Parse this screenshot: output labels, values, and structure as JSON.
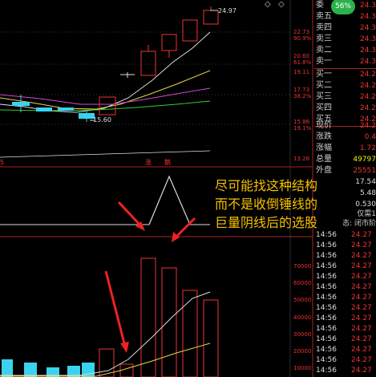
{
  "kline": {
    "last_price_label": "24.97",
    "low_price_label": "15.60",
    "axis_prices": [
      "22.73",
      "90.9%",
      "20.60",
      "61.8%",
      "19.11",
      "17.73",
      "38.2%",
      "15.86",
      "19.1%",
      "13.26"
    ],
    "marker_left": "5",
    "marker_mid": "涨",
    "marker_right": "鹅"
  },
  "volume_axis": [
    "70000",
    "60000",
    "50000",
    "40000",
    "30000",
    "20000",
    "10000"
  ],
  "annotation": {
    "line1": "尽可能找这种结构",
    "line2": "而不是收倒锤线的",
    "line3": "巨量阴线后的选股"
  },
  "badge": {
    "percent": "56%"
  },
  "quote_panel": {
    "header_label": "委",
    "sells": [
      {
        "label": "卖五",
        "value": "24.3"
      },
      {
        "label": "卖四",
        "value": "24.3"
      },
      {
        "label": "卖三",
        "value": "24.3"
      },
      {
        "label": "卖二",
        "value": "24.3"
      },
      {
        "label": "卖一",
        "value": "24.3"
      }
    ],
    "header_value": "24.3",
    "buys": [
      {
        "label": "买一",
        "value": "24.2"
      },
      {
        "label": "买二",
        "value": "24.2"
      },
      {
        "label": "买三",
        "value": "24.2"
      },
      {
        "label": "买四",
        "value": "24.2"
      },
      {
        "label": "买五",
        "value": "24.2"
      }
    ],
    "stats": [
      {
        "label": "现价",
        "value": "24.2"
      },
      {
        "label": "涨跌",
        "value": "0.4"
      },
      {
        "label": "涨幅",
        "value": "1.72"
      },
      {
        "label": "总量",
        "value": "49797"
      },
      {
        "label": "外盘",
        "value": "25551"
      }
    ],
    "extra_values": [
      "17.54",
      "5.48",
      "0.530"
    ],
    "status_line1": "仅需1",
    "status_line2": "态: 闭市阶"
  },
  "ticks": [
    {
      "time": "14:56",
      "price": "24.27"
    },
    {
      "time": "14:56",
      "price": "24.27"
    },
    {
      "time": "14:56",
      "price": "24.27"
    },
    {
      "time": "14:56",
      "price": "24.27"
    },
    {
      "time": "14:56",
      "price": "24.27"
    },
    {
      "time": "14:56",
      "price": "24.27"
    },
    {
      "time": "14:56",
      "price": "24.27"
    },
    {
      "time": "14:56",
      "price": "24.27"
    },
    {
      "time": "14:56",
      "price": "24.27"
    },
    {
      "time": "14:56",
      "price": "24.27"
    },
    {
      "time": "14:56",
      "price": "24.27"
    },
    {
      "time": "14:56",
      "price": "24.27"
    },
    {
      "time": "14:56",
      "price": "24.27"
    },
    {
      "time": "14:56",
      "price": "24.27"
    }
  ]
}
